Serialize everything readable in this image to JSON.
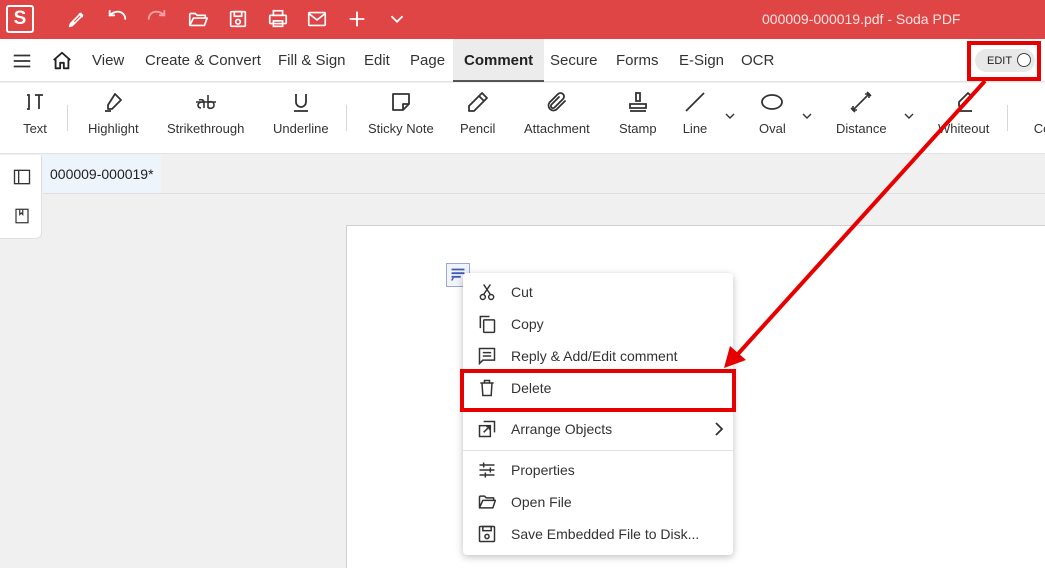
{
  "app": {
    "logo_letter": "S",
    "window_title": "000009-000019.pdf  -  Soda PDF",
    "brand_color": "#e04545"
  },
  "titlebar_icons": [
    "pen-icon",
    "undo-icon",
    "redo-icon",
    "open-folder-icon",
    "save-icon",
    "print-icon",
    "mail-icon",
    "plus-icon",
    "chevron-down-icon"
  ],
  "menu": {
    "items": [
      "View",
      "Create & Convert",
      "Fill & Sign",
      "Edit",
      "Page",
      "Comment",
      "Secure",
      "Forms",
      "E-Sign",
      "OCR"
    ],
    "active": "Comment",
    "edit_toggle_label": "EDIT"
  },
  "toolbar": {
    "tools": [
      {
        "label": "Text",
        "icon": "text-cursor-icon"
      },
      {
        "label": "Highlight",
        "icon": "highlighter-icon"
      },
      {
        "label": "Strikethrough",
        "icon": "strikethrough-icon"
      },
      {
        "label": "Underline",
        "icon": "underline-icon"
      },
      {
        "label": "Sticky Note",
        "icon": "sticky-note-icon"
      },
      {
        "label": "Pencil",
        "icon": "pencil-icon"
      },
      {
        "label": "Attachment",
        "icon": "paperclip-icon"
      },
      {
        "label": "Stamp",
        "icon": "stamp-icon"
      },
      {
        "label": "Line",
        "icon": "line-icon"
      },
      {
        "label": "Oval",
        "icon": "oval-icon"
      },
      {
        "label": "Distance",
        "icon": "distance-icon"
      },
      {
        "label": "Whiteout",
        "icon": "whiteout-icon"
      },
      {
        "label": "Co",
        "icon": ""
      }
    ]
  },
  "document": {
    "tab_name": "000009-000019*"
  },
  "context_menu": {
    "items": [
      {
        "label": "Cut",
        "icon": "scissors-icon"
      },
      {
        "label": "Copy",
        "icon": "copy-icon"
      },
      {
        "label": "Reply & Add/Edit comment",
        "icon": "comment-icon"
      },
      {
        "label": "Delete",
        "icon": "trash-icon"
      },
      {
        "label": "Arrange Objects",
        "icon": "arrange-icon",
        "has_submenu": true
      },
      {
        "label": "Properties",
        "icon": "sliders-icon"
      },
      {
        "label": "Open File",
        "icon": "folder-open-icon"
      },
      {
        "label": "Save Embedded File to Disk...",
        "icon": "save-disk-icon"
      }
    ],
    "highlighted": "Delete",
    "highlight_color": "#e60000"
  }
}
